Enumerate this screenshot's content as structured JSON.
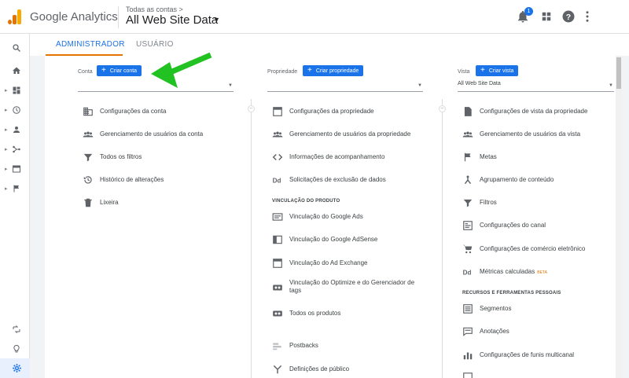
{
  "header": {
    "app_name": "Google Analytics",
    "breadcrumb": "Todas as contas >",
    "view_title": "All Web Site Data",
    "notification_count": "1"
  },
  "tabs": [
    {
      "label": "ADMINISTRADOR",
      "active": true
    },
    {
      "label": "USUÁRIO",
      "active": false
    }
  ],
  "account": {
    "label": "Conta",
    "create_label": "Criar conta",
    "select_value": "",
    "items": [
      {
        "label": "Configurações da conta",
        "icon": "building-icon"
      },
      {
        "label": "Gerenciamento de usuários da conta",
        "icon": "people-icon"
      },
      {
        "label": "Todos os filtros",
        "icon": "filter-icon"
      },
      {
        "label": "Histórico de alterações",
        "icon": "history-icon"
      },
      {
        "label": "Lixeira",
        "icon": "trash-icon"
      }
    ]
  },
  "property": {
    "label": "Propriedade",
    "create_label": "Criar propriedade",
    "select_value": "",
    "items": [
      {
        "label": "Configurações da propriedade",
        "icon": "window-icon"
      },
      {
        "label": "Gerenciamento de usuários da propriedade",
        "icon": "people-icon"
      },
      {
        "label": "Informações de acompanhamento",
        "icon": "code-icon"
      },
      {
        "label": "Solicitações de exclusão de dados",
        "icon": "dd-icon"
      }
    ],
    "section_label": "VINCULAÇÃO DO PRODUTO",
    "link_items": [
      {
        "label": "Vinculação do Google Ads",
        "icon": "ads-icon"
      },
      {
        "label": "Vinculação do Google AdSense",
        "icon": "adsense-icon"
      },
      {
        "label": "Vinculação do Ad Exchange",
        "icon": "window-icon"
      },
      {
        "label": "Vinculação do Optimize e do Gerenciador de tags",
        "icon": "link-icon"
      },
      {
        "label": "Todos os produtos",
        "icon": "link-icon"
      },
      {
        "label": "Postbacks",
        "icon": "postback-icon"
      },
      {
        "label": "Definições de público",
        "icon": "audience-icon"
      }
    ]
  },
  "view": {
    "label": "Vista",
    "create_label": "Criar vista",
    "select_value": "All Web Site Data",
    "items": [
      {
        "label": "Configurações de vista da propriedade",
        "icon": "document-icon"
      },
      {
        "label": "Gerenciamento de usuários da vista",
        "icon": "people-icon"
      },
      {
        "label": "Metas",
        "icon": "flag-icon"
      },
      {
        "label": "Agrupamento de conteúdo",
        "icon": "grouping-icon"
      },
      {
        "label": "Filtros",
        "icon": "filter-icon"
      },
      {
        "label": "Configurações do canal",
        "icon": "channel-icon"
      },
      {
        "label": "Configurações de comércio eletrônico",
        "icon": "cart-icon"
      },
      {
        "label": "Métricas calculadas",
        "icon": "dd-icon",
        "badge": "BETA"
      }
    ],
    "section_label": "RECURSOS E FERRAMENTAS PESSOAIS",
    "tool_items": [
      {
        "label": "Segmentos",
        "icon": "segments-icon"
      },
      {
        "label": "Anotações",
        "icon": "annotation-icon"
      },
      {
        "label": "Configurações de funis multicanal",
        "icon": "bars-icon"
      }
    ]
  },
  "colors": {
    "accent": "#1a73e8",
    "tab_underline": "#e37400",
    "arrow": "#22c222"
  }
}
